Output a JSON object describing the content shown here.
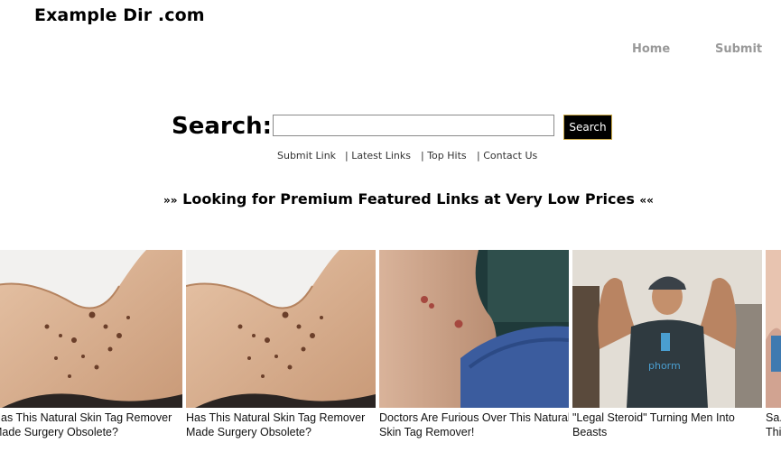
{
  "site": {
    "title": "Example Dir .com"
  },
  "nav": {
    "home": "Home",
    "submit": "Submit"
  },
  "search": {
    "label": "Search:",
    "value": "",
    "button": "Search"
  },
  "sub_links": [
    "Submit Link",
    "| Latest Links",
    "| Top Hits",
    "| Contact Us"
  ],
  "promo": {
    "left_arrows": "»»",
    "text": "Looking for Premium Featured Links at Very Low Prices",
    "right_arrows": "««"
  },
  "ads": [
    {
      "caption": "Has This Natural Skin Tag Remover Made Surgery Obsolete?",
      "image": "neck-skin-tags-photo"
    },
    {
      "caption": "Has This Natural Skin Tag Remover Made Surgery Obsolete?",
      "image": "neck-skin-tags-photo"
    },
    {
      "caption": "Doctors Are Furious Over This Natural Skin Tag Remover!",
      "image": "neck-skin-tag-closeup-photo"
    },
    {
      "caption": "\"Legal Steroid\" Turning Men Into Beasts",
      "image": "flexing-man-photo"
    },
    {
      "caption": "Sa... Thi...",
      "image": "partial-ad-photo"
    }
  ]
}
